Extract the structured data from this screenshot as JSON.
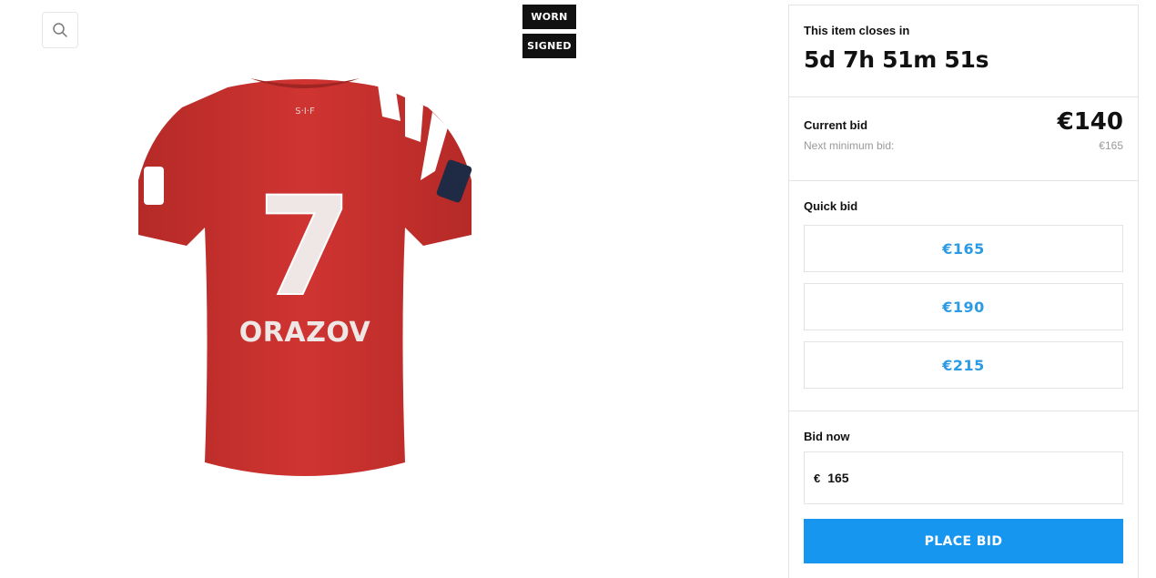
{
  "product": {
    "badges": {
      "worn": "WORN",
      "signed": "SIGNED"
    },
    "jersey": {
      "number": "7",
      "name": "ORAZOV",
      "crest": "S·I·F",
      "color": "#c9302c"
    }
  },
  "auction": {
    "closes_label": "This item closes in",
    "countdown": "5d 7h 51m 51s",
    "current_bid_label": "Current bid",
    "current_bid_value": "€140",
    "next_min_label": "Next minimum bid:",
    "next_min_value": "€165",
    "quick_bid_label": "Quick bid",
    "quick_bids": [
      "€165",
      "€190",
      "€215"
    ],
    "bid_now_label": "Bid now",
    "currency_symbol": "€",
    "bid_input_value": "165",
    "place_bid_label": "PLACE BID"
  },
  "colors": {
    "accent": "#1796f0",
    "quick_bid_text": "#2b9be6",
    "tag_bg": "#111111"
  }
}
